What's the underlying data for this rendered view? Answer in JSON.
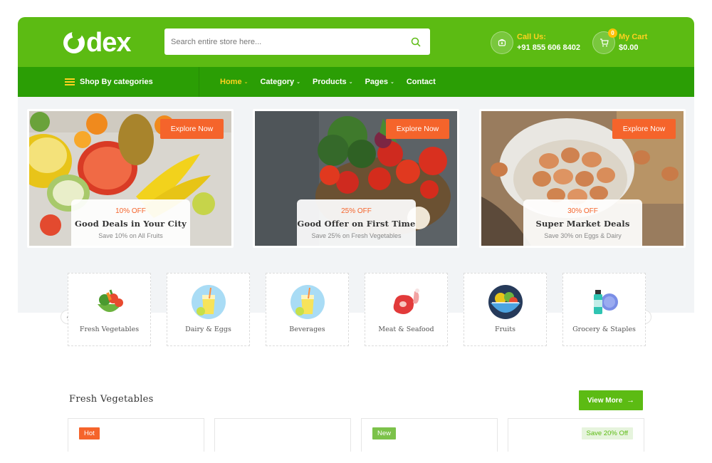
{
  "header": {
    "logo_text": "dex",
    "search_placeholder": "Search entire store here...",
    "call_label": "Call Us:",
    "call_number": "+91 855 606 8402",
    "cart_label": "My Cart",
    "cart_total": "$0.00",
    "cart_count": "0"
  },
  "nav": {
    "categories_label": "Shop By categories",
    "items": [
      {
        "label": "Home",
        "active": true,
        "dropdown": true
      },
      {
        "label": "Category",
        "active": false,
        "dropdown": true
      },
      {
        "label": "Products",
        "active": false,
        "dropdown": true
      },
      {
        "label": "Pages",
        "active": false,
        "dropdown": true
      },
      {
        "label": "Contact",
        "active": false,
        "dropdown": false
      }
    ]
  },
  "banners": [
    {
      "button": "Explore Now",
      "offer": "10% OFF",
      "title": "Good Deals in Your City",
      "subtitle": "Save 10% on All Fruits"
    },
    {
      "button": "Explore Now",
      "offer": "25% OFF",
      "title": "Good Offer on First Time",
      "subtitle": "Save 25% on Fresh Vegetables"
    },
    {
      "button": "Explore Now",
      "offer": "30% OFF",
      "title": "Super Market Deals",
      "subtitle": "Save 30% on Eggs & Dairy"
    }
  ],
  "categories": [
    {
      "name": "Fresh Vegetables",
      "icon": "vegetables-icon"
    },
    {
      "name": "Dairy & Eggs",
      "icon": "juice-icon"
    },
    {
      "name": "Beverages",
      "icon": "juice-icon"
    },
    {
      "name": "Meat & Seafood",
      "icon": "meat-icon"
    },
    {
      "name": "Fruits",
      "icon": "fruit-bowl-icon"
    },
    {
      "name": "Grocery & Staples",
      "icon": "grocery-icon"
    }
  ],
  "section": {
    "title": "Fresh Vegetables",
    "view_more": "View More"
  },
  "products": [
    {
      "badge": "Hot",
      "badge_color": "#f5642b"
    },
    {
      "badge": "",
      "badge_color": ""
    },
    {
      "badge": "New",
      "badge_color": "#7cc24a"
    },
    {
      "badge": "Save 20% Off",
      "badge_color": "#e6f4dd"
    }
  ],
  "colors": {
    "brand_green": "#5cbb13",
    "nav_green": "#2b9e05",
    "accent_orange": "#f5642b",
    "accent_yellow": "#ffd21f"
  }
}
